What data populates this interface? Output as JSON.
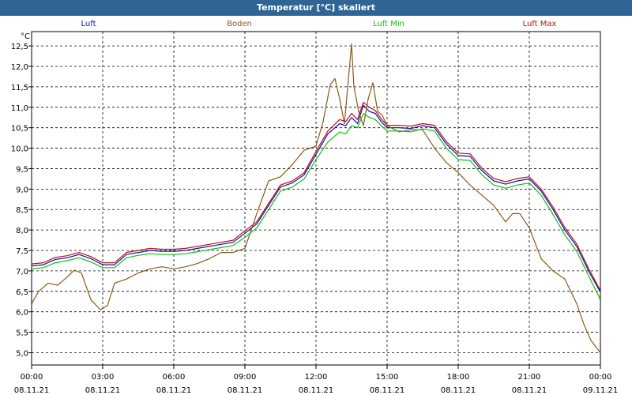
{
  "window": {
    "title": "Temperatur [°C] skaliert"
  },
  "chart_data": {
    "type": "line",
    "title": "Temperatur [°C] skaliert",
    "ylabel": "°C",
    "ylim": [
      4.7,
      12.85
    ],
    "yticks": [
      5.0,
      5.5,
      6.0,
      6.5,
      7.0,
      7.5,
      8.0,
      8.5,
      9.0,
      9.5,
      10.0,
      10.5,
      11.0,
      11.5,
      12.0,
      12.5
    ],
    "ytick_labels": [
      "5,0",
      "5,5",
      "6,0",
      "6,5",
      "7,0",
      "7,5",
      "8,0",
      "8,5",
      "9,0",
      "9,5",
      "10,0",
      "10,5",
      "11,0",
      "11,5",
      "12,0",
      "12,5"
    ],
    "xlim": [
      0,
      24
    ],
    "xticks": [
      0,
      3,
      6,
      9,
      12,
      15,
      18,
      21,
      24
    ],
    "xtick_time_labels": [
      "00:00",
      "03:00",
      "06:00",
      "09:00",
      "12:00",
      "15:00",
      "18:00",
      "21:00",
      "00:00"
    ],
    "xtick_date_labels": [
      "08.11.21",
      "08.11.21",
      "08.11.21",
      "08.11.21",
      "08.11.21",
      "08.11.21",
      "08.11.21",
      "08.11.21",
      "09.11.21"
    ],
    "grid": true,
    "legend_position": "top",
    "series": [
      {
        "name": "Luft",
        "color": "#1010c0",
        "x": [
          0,
          0.5,
          1,
          1.5,
          2,
          2.5,
          3,
          3.5,
          4,
          4.5,
          5,
          5.5,
          6,
          6.5,
          7,
          7.5,
          8,
          8.5,
          9,
          9.5,
          10,
          10.5,
          11,
          11.5,
          12,
          12.5,
          13,
          13.25,
          13.5,
          13.75,
          14,
          14.25,
          14.5,
          14.75,
          15,
          15.5,
          16,
          16.5,
          17,
          17.5,
          18,
          18.5,
          19,
          19.5,
          20,
          20.5,
          21,
          21.5,
          22,
          22.5,
          23,
          23.5,
          24
        ],
        "y": [
          7.12,
          7.15,
          7.28,
          7.32,
          7.4,
          7.3,
          7.15,
          7.15,
          7.4,
          7.45,
          7.5,
          7.48,
          7.48,
          7.5,
          7.55,
          7.6,
          7.65,
          7.7,
          7.92,
          8.15,
          8.6,
          9.05,
          9.15,
          9.35,
          9.85,
          10.35,
          10.6,
          10.55,
          10.75,
          10.6,
          11.05,
          10.9,
          10.85,
          10.65,
          10.5,
          10.5,
          10.48,
          10.55,
          10.5,
          10.1,
          9.82,
          9.8,
          9.45,
          9.2,
          9.12,
          9.2,
          9.25,
          8.95,
          8.5,
          8.0,
          7.6,
          7.0,
          6.48
        ]
      },
      {
        "name": "Boden",
        "color": "#8b5a1a",
        "x": [
          0,
          0.3,
          0.7,
          1.1,
          1.5,
          1.8,
          2.1,
          2.5,
          2.9,
          3.2,
          3.5,
          4,
          4.5,
          5,
          5.5,
          6,
          6.5,
          7,
          7.5,
          8,
          8.5,
          9,
          9.5,
          10,
          10.5,
          11,
          11.5,
          12,
          12.3,
          12.6,
          12.8,
          13,
          13.2,
          13.4,
          13.5,
          13.6,
          13.8,
          14,
          14.2,
          14.4,
          14.6,
          14.8,
          15,
          15.5,
          16,
          16.5,
          17,
          17.5,
          18,
          18.5,
          19,
          19.5,
          20,
          20.3,
          20.6,
          21,
          21.5,
          22,
          22.5,
          23,
          23.3,
          23.6,
          24
        ],
        "y": [
          6.2,
          6.5,
          6.7,
          6.65,
          6.85,
          7.02,
          6.95,
          6.3,
          6.05,
          6.15,
          6.7,
          6.8,
          6.95,
          7.05,
          7.1,
          7.05,
          7.1,
          7.18,
          7.3,
          7.45,
          7.45,
          7.55,
          8.4,
          9.2,
          9.3,
          9.6,
          9.95,
          10.05,
          10.65,
          11.55,
          11.7,
          11.2,
          10.6,
          11.9,
          12.55,
          11.5,
          10.9,
          10.55,
          11.2,
          11.6,
          10.9,
          10.8,
          10.55,
          10.4,
          10.45,
          10.45,
          10.0,
          9.65,
          9.4,
          9.1,
          8.85,
          8.6,
          8.2,
          8.4,
          8.4,
          8.05,
          7.3,
          7.0,
          6.8,
          6.2,
          5.7,
          5.3,
          5.0
        ]
      },
      {
        "name": "Luft Min",
        "color": "#10c010",
        "x": [
          0,
          0.5,
          1,
          1.5,
          2,
          2.5,
          3,
          3.5,
          4,
          4.5,
          5,
          5.5,
          6,
          6.5,
          7,
          7.5,
          8,
          8.5,
          9,
          9.5,
          10,
          10.5,
          11,
          11.5,
          12,
          12.5,
          13,
          13.25,
          13.5,
          13.75,
          14,
          14.25,
          14.5,
          14.75,
          15,
          15.5,
          16,
          16.5,
          17,
          17.5,
          18,
          18.5,
          19,
          19.5,
          20,
          20.5,
          21,
          21.5,
          22,
          22.5,
          23,
          23.5,
          24
        ],
        "y": [
          7.05,
          7.08,
          7.2,
          7.25,
          7.32,
          7.22,
          7.08,
          7.08,
          7.32,
          7.38,
          7.42,
          7.4,
          7.4,
          7.42,
          7.47,
          7.52,
          7.57,
          7.62,
          7.82,
          8.05,
          8.5,
          8.95,
          9.05,
          9.25,
          9.72,
          10.15,
          10.4,
          10.35,
          10.55,
          10.5,
          10.85,
          10.75,
          10.7,
          10.55,
          10.42,
          10.42,
          10.4,
          10.47,
          10.42,
          10.0,
          9.72,
          9.7,
          9.35,
          9.1,
          9.02,
          9.1,
          9.15,
          8.85,
          8.38,
          7.88,
          7.48,
          6.88,
          6.3
        ]
      },
      {
        "name": "Luft Max",
        "color": "#c01010",
        "x": [
          0,
          0.5,
          1,
          1.5,
          2,
          2.5,
          3,
          3.5,
          4,
          4.5,
          5,
          5.5,
          6,
          6.5,
          7,
          7.5,
          8,
          8.5,
          9,
          9.5,
          10,
          10.5,
          11,
          11.5,
          12,
          12.5,
          13,
          13.25,
          13.5,
          13.75,
          14,
          14.25,
          14.5,
          14.75,
          15,
          15.5,
          16,
          16.5,
          17,
          17.5,
          18,
          18.5,
          19,
          19.5,
          20,
          20.5,
          21,
          21.5,
          22,
          22.5,
          23,
          23.5,
          24
        ],
        "y": [
          7.17,
          7.2,
          7.33,
          7.37,
          7.45,
          7.35,
          7.2,
          7.2,
          7.45,
          7.5,
          7.55,
          7.53,
          7.53,
          7.55,
          7.6,
          7.65,
          7.7,
          7.75,
          7.98,
          8.2,
          8.65,
          9.1,
          9.2,
          9.4,
          9.92,
          10.42,
          10.7,
          10.65,
          10.85,
          10.7,
          11.12,
          11.0,
          10.92,
          10.72,
          10.56,
          10.56,
          10.54,
          10.6,
          10.56,
          10.16,
          9.88,
          9.86,
          9.51,
          9.26,
          9.18,
          9.26,
          9.3,
          9.0,
          8.56,
          8.06,
          7.66,
          7.06,
          6.52
        ]
      }
    ]
  }
}
